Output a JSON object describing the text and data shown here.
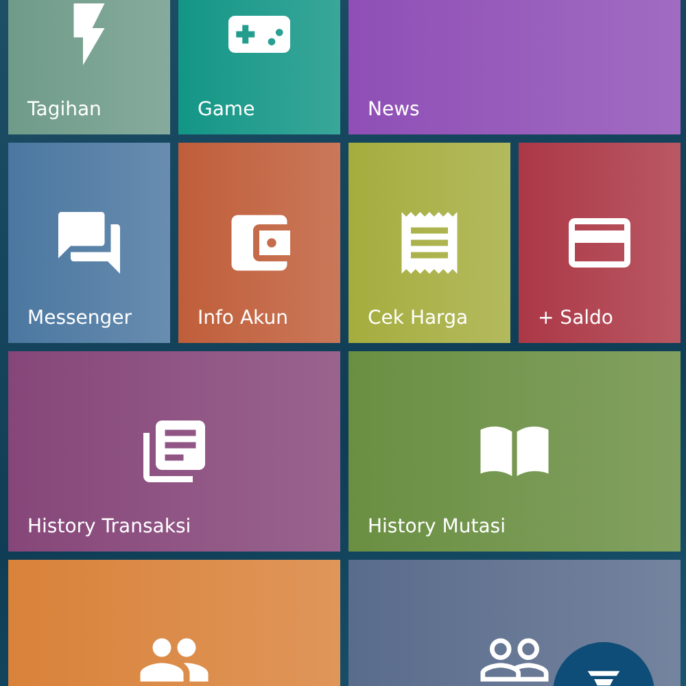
{
  "tiles": [
    {
      "label": "Tagihan",
      "color": "#6f9b89"
    },
    {
      "label": "Game",
      "color": "#139686"
    },
    {
      "label": "News",
      "color": "#8f4fb6"
    },
    {
      "label": "Messenger",
      "color": "#4b77a0"
    },
    {
      "label": "Info Akun",
      "color": "#c05e3a"
    },
    {
      "label": "Cek Harga",
      "color": "#a5ad3e"
    },
    {
      "label": "+ Saldo",
      "color": "#ac3846"
    },
    {
      "label": "History Transaksi",
      "color": "#864679"
    },
    {
      "label": "History Mutasi",
      "color": "#6a8f42"
    },
    {
      "color": "#d9823a"
    },
    {
      "color": "#5a6c8c"
    }
  ]
}
